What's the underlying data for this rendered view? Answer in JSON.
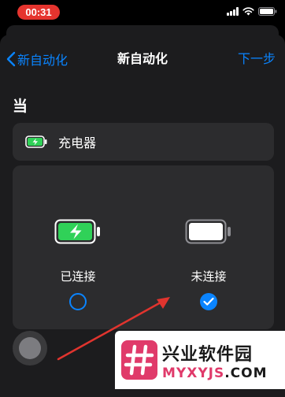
{
  "status_bar": {
    "time": "00:31"
  },
  "nav": {
    "back_label": "新自动化",
    "title": "新自动化",
    "next_label": "下一步"
  },
  "section": {
    "header": "当"
  },
  "trigger": {
    "label": "充电器",
    "icon": "battery-charging-icon"
  },
  "options": [
    {
      "label": "已连接",
      "icon": "battery-charging-icon",
      "selected": false
    },
    {
      "label": "未连接",
      "icon": "battery-full-icon",
      "selected": true
    }
  ],
  "watermark": {
    "name": "兴业软件园",
    "domain_prefix": "MYXYJS",
    "domain_suffix": ".COM"
  },
  "colors": {
    "accent": "#0a84ff",
    "charge_green": "#30d158",
    "annotation_red": "#e0342e",
    "status_time_bg": "#e5342e"
  }
}
